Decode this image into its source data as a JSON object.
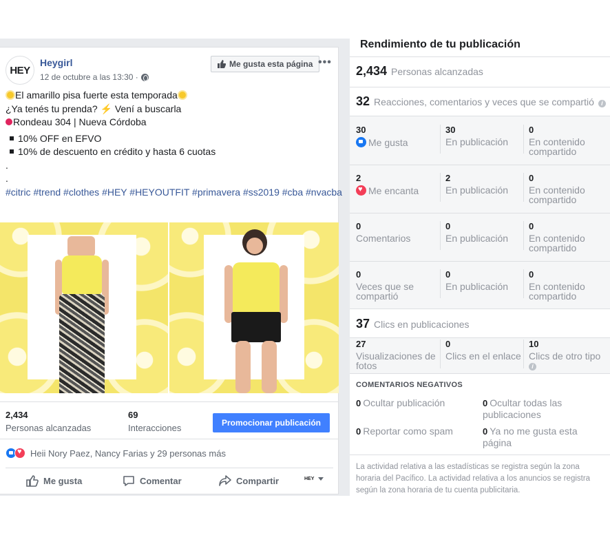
{
  "post": {
    "page_name": "Heygirl",
    "avatar_text": "HEY",
    "date": "12 de octubre a las 13:30 ·",
    "like_page_label": "Me gusta esta página",
    "text_lines": [
      "El amarillo pisa fuerte esta temporada",
      "¿Ya tenés tu prenda?",
      "Vení a buscarla",
      "Rondeau 304 | Nueva Córdoba",
      "10% OFF en EFVO",
      "10% de descuento en crédito y hasta 6 cuotas",
      ".",
      "."
    ],
    "hashtags": "#citric #trend #clothes #HEY #HEYOUTFIT #primavera #ss2019 #cba #nvacba",
    "stats": {
      "reach_value": "2,434",
      "reach_label": "Personas alcanzadas",
      "interactions_value": "69",
      "interactions_label": "Interacciones"
    },
    "promote_label": "Promocionar publicación",
    "reactions_text": "Heii Nory Paez, Nancy Farias y 29 personas más",
    "actions": {
      "like": "Me gusta",
      "comment": "Comentar",
      "share": "Compartir",
      "page_mini": "HEY"
    }
  },
  "panel": {
    "title": "Rendimiento de tu publicación",
    "reach": {
      "value": "2,434",
      "label": "Personas alcanzadas"
    },
    "engagement": {
      "value": "32",
      "label": "Reacciones, comentarios y veces que se compartió"
    },
    "rows": [
      {
        "total": "30",
        "label": "Me gusta",
        "on_post": "30",
        "on_post_label": "En publicación",
        "shared": "0",
        "shared_label": "En contenido compartido"
      },
      {
        "total": "2",
        "label": "Me encanta",
        "on_post": "2",
        "on_post_label": "En publicación",
        "shared": "0",
        "shared_label": "En contenido compartido"
      },
      {
        "total": "0",
        "label": "Comentarios",
        "on_post": "0",
        "on_post_label": "En publicación",
        "shared": "0",
        "shared_label": "En contenido compartido"
      },
      {
        "total": "0",
        "label": "Veces que se compartió",
        "on_post": "0",
        "on_post_label": "En publicación",
        "shared": "0",
        "shared_label": "En contenido compartido"
      }
    ],
    "clicks": {
      "value": "37",
      "label": "Clics en publicaciones",
      "photo_views_value": "27",
      "photo_views_label": "Visualizaciones de fotos",
      "link_clicks_value": "0",
      "link_clicks_label": "Clics en el enlace",
      "other_clicks_value": "10",
      "other_clicks_label": "Clics de otro tipo"
    },
    "negative": {
      "title": "COMENTARIOS NEGATIVOS",
      "hide_post_value": "0",
      "hide_post_label": "Ocultar publicación",
      "hide_all_value": "0",
      "hide_all_label": "Ocultar todas las publicaciones",
      "spam_value": "0",
      "spam_label": "Reportar como spam",
      "unlike_value": "0",
      "unlike_label": "Ya no me gusta esta página"
    },
    "footnote": "La actividad relativa a las estadísticas se registra según la zona horaria del Pacífico. La actividad relativa a los anuncios se registra según la zona horaria de tu cuenta publicitaria."
  },
  "colors": {
    "link": "#385898",
    "button_blue": "#4080ff",
    "like_blue": "#1877f2",
    "love_red": "#f33e58",
    "lemon_yellow": "#f4e56a"
  }
}
